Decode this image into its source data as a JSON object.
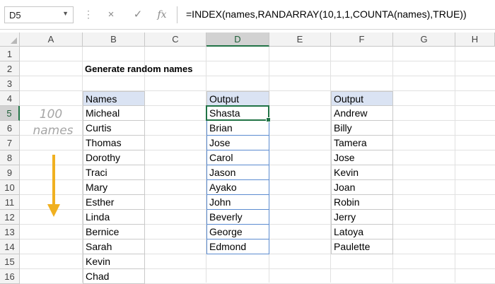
{
  "formula_bar": {
    "name_box": "D5",
    "cancel_icon": "×",
    "enter_icon": "✓",
    "fx_label": "fx",
    "formula": "=INDEX(names,RANDARRAY(10,1,1,COUNTA(names),TRUE))"
  },
  "columns": [
    "A",
    "B",
    "C",
    "D",
    "E",
    "F",
    "G",
    "H"
  ],
  "rows": [
    "1",
    "2",
    "3",
    "4",
    "5",
    "6",
    "7",
    "8",
    "9",
    "10",
    "11",
    "12",
    "13",
    "14",
    "15",
    "16"
  ],
  "title": "Generate random names",
  "annotation": {
    "line1": "100",
    "line2": "names"
  },
  "names_table": {
    "header": "Names",
    "items": [
      "Micheal",
      "Curtis",
      "Thomas",
      "Dorothy",
      "Traci",
      "Mary",
      "Esther",
      "Linda",
      "Bernice",
      "Sarah",
      "Kevin",
      "Chad"
    ]
  },
  "output1": {
    "header": "Output",
    "items": [
      "Shasta",
      "Brian",
      "Jose",
      "Carol",
      "Jason",
      "Ayako",
      "John",
      "Beverly",
      "George",
      "Edmond"
    ]
  },
  "output2": {
    "header": "Output",
    "items": [
      "Andrew",
      "Billy",
      "Tamera",
      "Jose",
      "Kevin",
      "Joan",
      "Robin",
      "Jerry",
      "Latoya",
      "Paulette"
    ]
  },
  "colors": {
    "accent_green": "#217346",
    "table_header_fill": "#dae3f3",
    "table_border": "#c9c9c9",
    "spill_border": "#5b8bd0",
    "arrow": "#f0b020"
  }
}
